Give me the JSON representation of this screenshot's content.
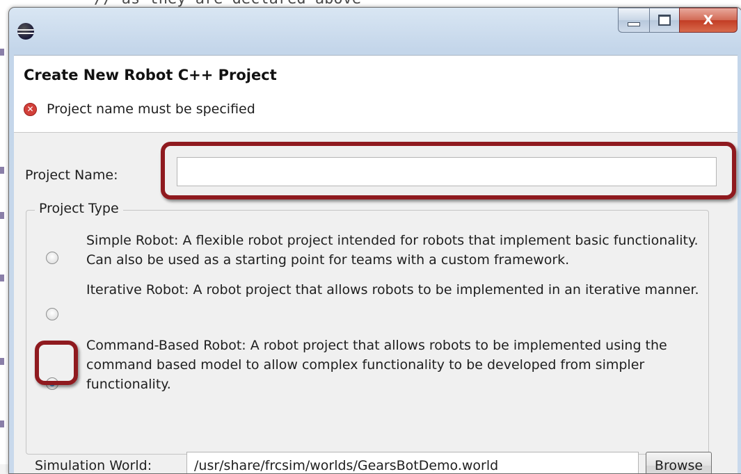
{
  "background": {
    "code_line": "// as they are declared above"
  },
  "window": {
    "icon": "eclipse-icon",
    "controls": {
      "minimize_icon": "minimize-icon",
      "maximize_icon": "maximize-icon",
      "close_label": "X"
    }
  },
  "header": {
    "title": "Create New Robot C++ Project",
    "error_icon": "error-icon",
    "error_message": "Project name must be specified"
  },
  "form": {
    "project_name_label": "Project Name:",
    "project_name_value": "",
    "project_type_legend": "Project Type",
    "project_types": [
      {
        "label": "Simple Robot: A flexible robot project intended for robots that implement basic functionality. Can also be used as a starting point for teams with a custom framework.",
        "selected": false
      },
      {
        "label": "Iterative Robot: A robot project that allows robots to be implemented in an iterative manner.",
        "selected": false
      },
      {
        "label": "Command-Based Robot: A robot project that allows robots to be implemented using the command based model to allow complex functionality to be developed from simpler functionality.",
        "selected": true
      }
    ],
    "simulation_world_label": "Simulation World:",
    "simulation_world_value": "/usr/share/frcsim/worlds/GearsBotDemo.world",
    "browse_label": "Browse"
  },
  "colors": {
    "highlight": "#8f1a1f",
    "error": "#d2403a",
    "radio_selected": "#1a6fc0"
  }
}
